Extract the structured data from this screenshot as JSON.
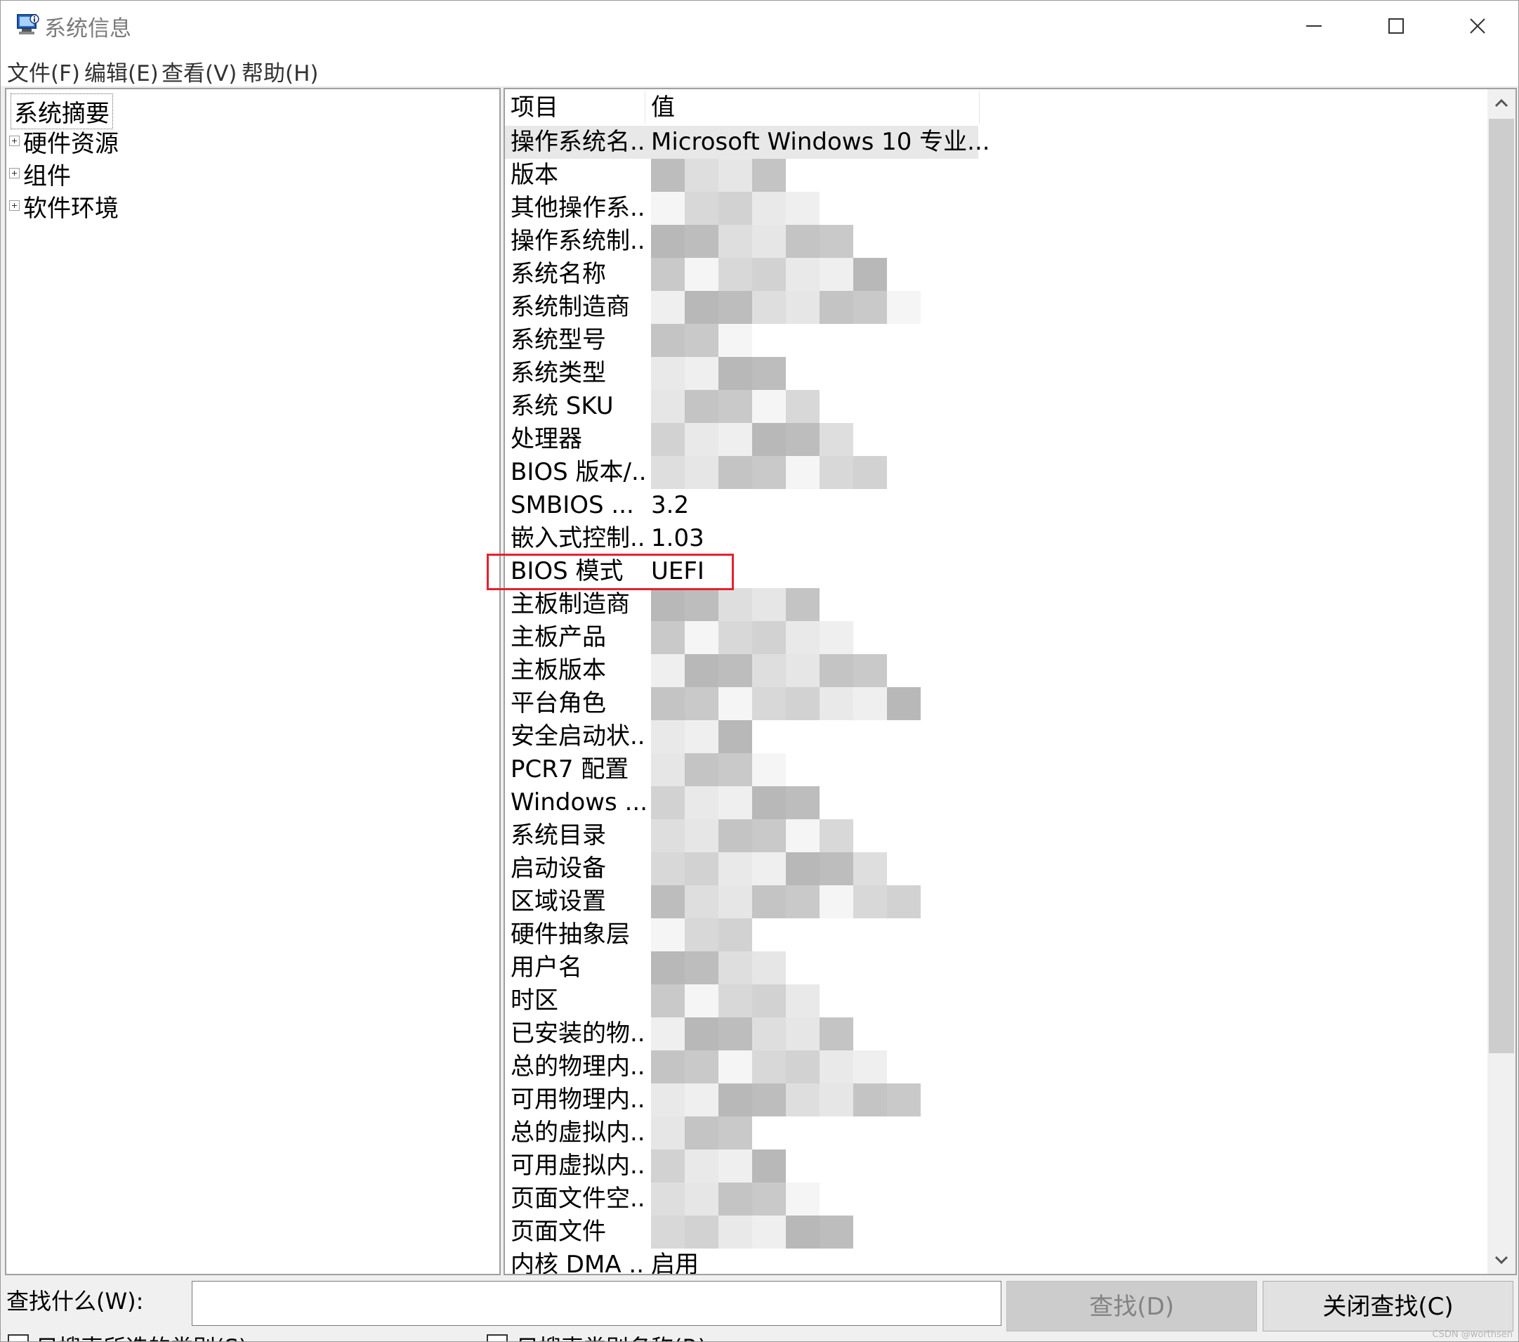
{
  "window": {
    "title": "系统信息",
    "icon": "system-info-icon",
    "controls": [
      "minimize-icon",
      "maximize-icon",
      "close-icon"
    ]
  },
  "menu": [
    "文件(F)",
    "编辑(E)",
    "查看(V)",
    "帮助(H)"
  ],
  "tree": {
    "root": "系统摘要",
    "children": [
      "硬件资源",
      "组件",
      "软件环境"
    ]
  },
  "list": {
    "columns": [
      "项目",
      "值"
    ],
    "rows": [
      {
        "item": "操作系统名...",
        "value": "Microsoft Windows 10 专业...",
        "selected": true
      },
      {
        "item": "版本",
        "value": ""
      },
      {
        "item": "其他操作系...",
        "value": ""
      },
      {
        "item": "操作系统制...",
        "value": ""
      },
      {
        "item": "系统名称",
        "value": ""
      },
      {
        "item": "系统制造商",
        "value": ""
      },
      {
        "item": "系统型号",
        "value": ""
      },
      {
        "item": "系统类型",
        "value": ""
      },
      {
        "item": "系统 SKU",
        "value": ""
      },
      {
        "item": "处理器",
        "value": ""
      },
      {
        "item": "BIOS 版本/...",
        "value": ""
      },
      {
        "item": "SMBIOS ...",
        "value": "3.2"
      },
      {
        "item": "嵌入式控制...",
        "value": "1.03"
      },
      {
        "item": "BIOS 模式",
        "value": "UEFI",
        "highlighted": true
      },
      {
        "item": "主板制造商",
        "value": ""
      },
      {
        "item": "主板产品",
        "value": ""
      },
      {
        "item": "主板版本",
        "value": ""
      },
      {
        "item": "平台角色",
        "value": ""
      },
      {
        "item": "安全启动状...",
        "value": ""
      },
      {
        "item": "PCR7 配置",
        "value": ""
      },
      {
        "item": "Windows ...",
        "value": ""
      },
      {
        "item": "系统目录",
        "value": ""
      },
      {
        "item": "启动设备",
        "value": ""
      },
      {
        "item": "区域设置",
        "value": ""
      },
      {
        "item": "硬件抽象层",
        "value": ""
      },
      {
        "item": "用户名",
        "value": ""
      },
      {
        "item": "时区",
        "value": ""
      },
      {
        "item": "已安装的物...",
        "value": ""
      },
      {
        "item": "总的物理内...",
        "value": ""
      },
      {
        "item": "可用物理内...",
        "value": ""
      },
      {
        "item": "总的虚拟内...",
        "value": ""
      },
      {
        "item": "可用虚拟内...",
        "value": ""
      },
      {
        "item": "页面文件空...",
        "value": ""
      },
      {
        "item": "页面文件",
        "value": ""
      },
      {
        "item": "内核 DMA ...",
        "value": "启用"
      }
    ]
  },
  "find": {
    "label": "查找什么(W):",
    "value": "",
    "find_button": "查找(D)",
    "close_button": "关闭查找(C)",
    "checkbox1": "只搜索所选的类别(S)",
    "checkbox2": "只搜索类别名称(R)"
  },
  "watermark": "CSDN @worthsen",
  "colors": {
    "highlight_box": "#e5212f",
    "selected_row": "#e8e8e8",
    "scroll_thumb": "#cdcdcd"
  }
}
